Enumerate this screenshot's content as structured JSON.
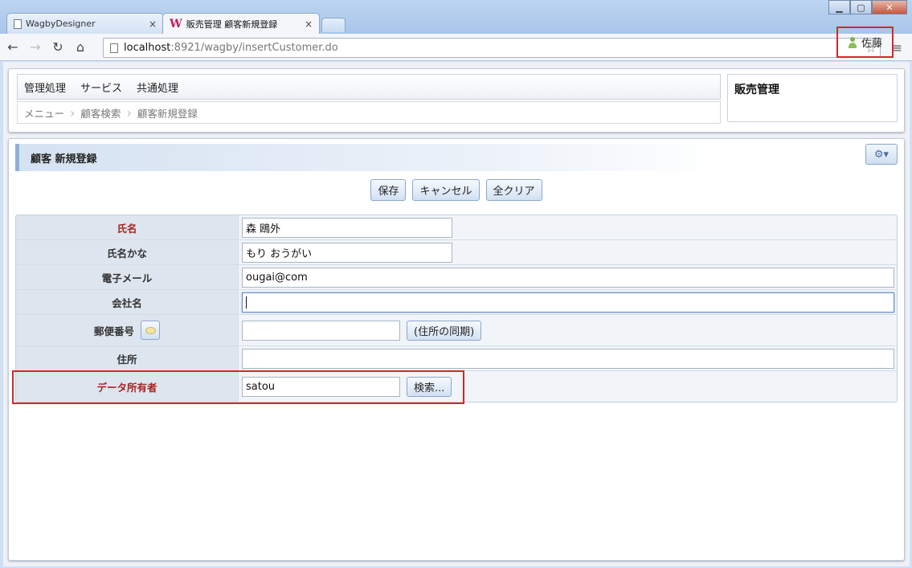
{
  "browser": {
    "tabs": [
      {
        "label": "WagbyDesigner",
        "close": "×"
      },
      {
        "label": "販売管理 顧客新規登録",
        "close": "×"
      }
    ],
    "window_controls": {
      "minimize": "▁",
      "maximize": "▢",
      "close": "✕"
    },
    "url_host": "localhost",
    "url_rest": ":8921/wagby/insertCustomer.do"
  },
  "header": {
    "menu": [
      "管理処理",
      "サービス",
      "共通処理"
    ],
    "breadcrumb": [
      "メニュー",
      "顧客検索",
      "顧客新規登録"
    ],
    "app_title": "販売管理",
    "user_name": "佐藤"
  },
  "section_title": "顧客 新規登録",
  "buttons": {
    "save": "保存",
    "cancel": "キャンセル",
    "clear_all": "全クリア"
  },
  "form": {
    "name": {
      "label": "氏名",
      "value": "森 鴎外"
    },
    "name_kana": {
      "label": "氏名かな",
      "value": "もり おうがい"
    },
    "email": {
      "label": "電子メール",
      "value": "ougai@com"
    },
    "company": {
      "label": "会社名",
      "value": ""
    },
    "postal": {
      "label": "郵便番号",
      "value": "",
      "sync_button": "(住所の同期)"
    },
    "address": {
      "label": "住所",
      "value": ""
    },
    "owner": {
      "label": "データ所有者",
      "value": "satou",
      "search_button": "検索..."
    }
  },
  "colors": {
    "required_label": "#a8231f",
    "highlight": "#d9242a",
    "accent": "#8fb0d9"
  }
}
